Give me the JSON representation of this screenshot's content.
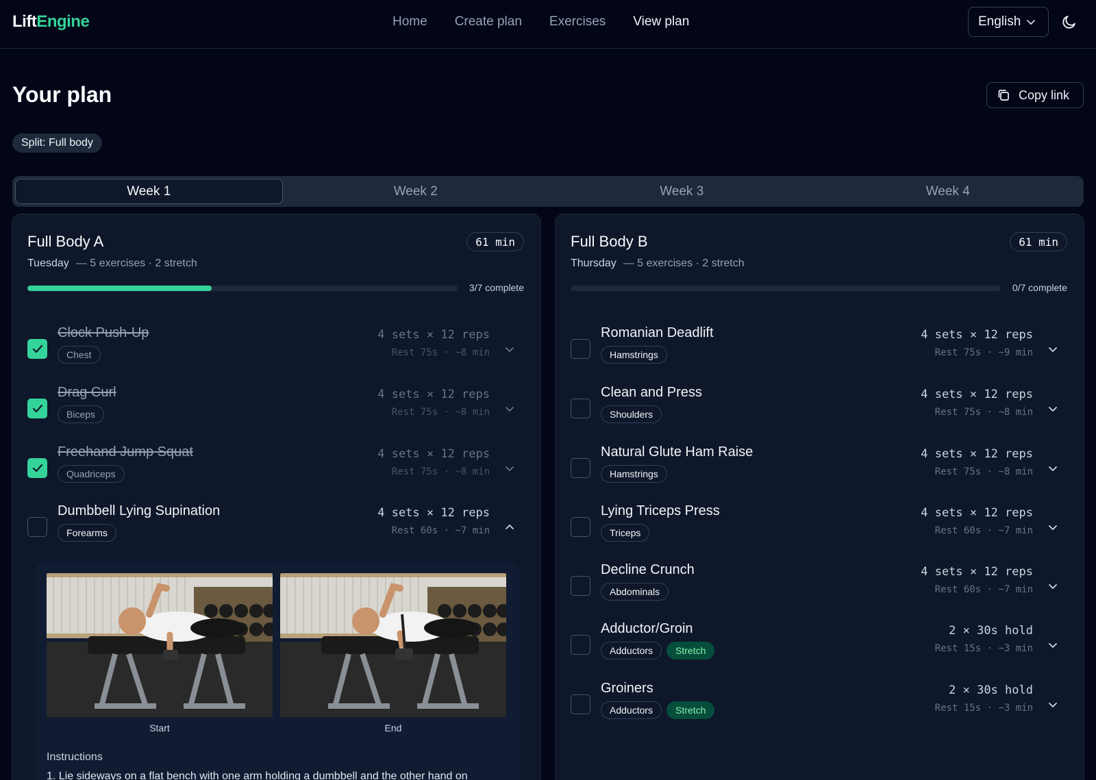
{
  "header": {
    "logo_part1": "Lift",
    "logo_part2": "Engine",
    "nav": [
      "Home",
      "Create plan",
      "Exercises",
      "View plan"
    ],
    "active_nav": "View plan",
    "language": "English"
  },
  "page": {
    "title": "Your plan",
    "copy_link": "Copy link",
    "split_badge": "Split: Full body"
  },
  "weeks": [
    "Week 1",
    "Week 2",
    "Week 3",
    "Week 4"
  ],
  "active_week": "Week 1",
  "colors": {
    "accent": "#34d399",
    "background": "#020617",
    "card": "#0f172a"
  },
  "days": [
    {
      "title": "Full Body A",
      "day": "Tuesday",
      "summary": "— 5 exercises · 2 stretch",
      "duration": "61 min",
      "progress_text": "3/7 complete",
      "progress": 0.4286,
      "exercises": [
        {
          "name": "Clock Push-Up",
          "tags": [
            "Chest"
          ],
          "sets": "4 sets × 12 reps",
          "rest": "Rest 75s · ~8 min",
          "done": true
        },
        {
          "name": "Drag Curl",
          "tags": [
            "Biceps"
          ],
          "sets": "4 sets × 12 reps",
          "rest": "Rest 75s · ~8 min",
          "done": true
        },
        {
          "name": "Freehand Jump Squat",
          "tags": [
            "Quadriceps"
          ],
          "sets": "4 sets × 12 reps",
          "rest": "Rest 75s · ~8 min",
          "done": true
        },
        {
          "name": "Dumbbell Lying Supination",
          "tags": [
            "Forearms"
          ],
          "sets": "4 sets × 12 reps",
          "rest": "Rest 60s · ~7 min",
          "done": false,
          "expanded": true
        }
      ],
      "detail": {
        "start_caption": "Start",
        "end_caption": "End",
        "instructions_title": "Instructions",
        "instruction_1": "1. Lie sideways on a flat bench with one arm holding a dumbbell and the other hand on"
      }
    },
    {
      "title": "Full Body B",
      "day": "Thursday",
      "summary": "— 5 exercises · 2 stretch",
      "duration": "61 min",
      "progress_text": "0/7 complete",
      "progress": 0,
      "exercises": [
        {
          "name": "Romanian Deadlift",
          "tags": [
            "Hamstrings"
          ],
          "sets": "4 sets × 12 reps",
          "rest": "Rest 75s · ~9 min",
          "done": false
        },
        {
          "name": "Clean and Press",
          "tags": [
            "Shoulders"
          ],
          "sets": "4 sets × 12 reps",
          "rest": "Rest 75s · ~8 min",
          "done": false
        },
        {
          "name": "Natural Glute Ham Raise",
          "tags": [
            "Hamstrings"
          ],
          "sets": "4 sets × 12 reps",
          "rest": "Rest 75s · ~8 min",
          "done": false
        },
        {
          "name": "Lying Triceps Press",
          "tags": [
            "Triceps"
          ],
          "sets": "4 sets × 12 reps",
          "rest": "Rest 60s · ~7 min",
          "done": false
        },
        {
          "name": "Decline Crunch",
          "tags": [
            "Abdominals"
          ],
          "sets": "4 sets × 12 reps",
          "rest": "Rest 60s · ~7 min",
          "done": false
        },
        {
          "name": "Adductor/Groin",
          "tags": [
            "Adductors",
            "Stretch"
          ],
          "sets": "2 × 30s hold",
          "rest": "Rest 15s · ~3 min",
          "done": false
        },
        {
          "name": "Groiners",
          "tags": [
            "Adductors",
            "Stretch"
          ],
          "sets": "2 × 30s hold",
          "rest": "Rest 15s · ~3 min",
          "done": false
        }
      ]
    }
  ]
}
